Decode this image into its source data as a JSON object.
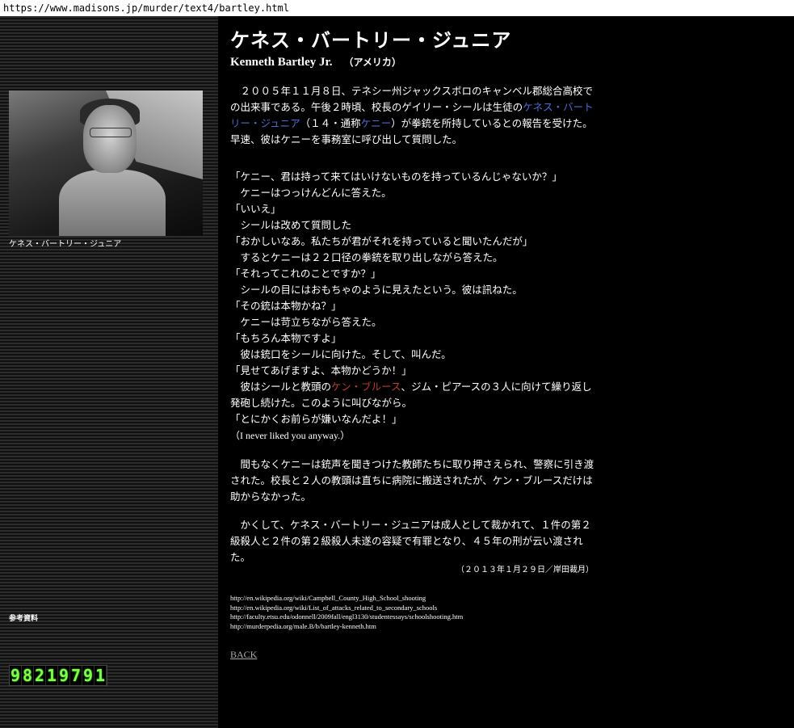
{
  "url": "https://www.madisons.jp/murder/text4/bartley.html",
  "sidebar": {
    "photo_caption": "ケネス・バートリー・ジュニア",
    "refs_label": "参考資料",
    "counter_digits": [
      "9",
      "8",
      "2",
      "1",
      "9",
      "7",
      "9",
      "1"
    ]
  },
  "header": {
    "title_ja": "ケネス・バートリー・ジュニア",
    "title_en": "Kenneth Bartley Jr.",
    "country": "（アメリカ）"
  },
  "p1": {
    "a": "　２００５年１１月８日、テネシー州ジャックスボロのキャンベル郡総合高校での出来事である。午後２時頃、校長のゲイリー・シールは生徒の",
    "link1": "ケネス・バートリー・ジュニア",
    "b": "（１４・通称",
    "link2": "ケニー",
    "c": "）が拳銃を所持しているとの報告を受けた。早速、彼はケニーを事務室に呼び出して質問した。"
  },
  "dialog": {
    "l1": "「ケニー、君は持って来てはいけないものを持っているんじゃないか？」",
    "l2": "　ケニーはつっけんどんに答えた。",
    "l3": "「いいえ」",
    "l4": "　シールは改めて質問した",
    "l5": "「おかしいなあ。私たちが君がそれを持っていると聞いたんだが」",
    "l6": "　するとケニーは２２口径の拳銃を取り出しながら答えた。",
    "l7": "「それってこれのことですか？」",
    "l8": "　シールの目にはおもちゃのように見えたという。彼は訊ねた。",
    "l9": "「その銃は本物かね？」",
    "l10": "　ケニーは苛立ちながら答えた。",
    "l11": "「もちろん本物ですよ」",
    "l12": "　彼は銃口をシールに向けた。そして、叫んだ。",
    "l13": "「見せてあげますよ、本物かどうか！」",
    "l14a": "　彼はシールと教頭の",
    "l14link": "ケン・ブルース",
    "l14b": "、ジム・ピアースの３人に向けて繰り返し発砲し続けた。このように叫びながら。",
    "l15": "「とにかくお前らが嫌いなんだよ！」",
    "l16": "（I never liked you anyway.）"
  },
  "p3": "　間もなくケニーは銃声を聞きつけた教師たちに取り押さえられ、警察に引き渡された。校長と２人の教頭は直ちに病院に搬送されたが、ケン・ブルースだけは助からなかった。",
  "p4": "　かくして、ケネス・バートリー・ジュニアは成人として裁かれて、１件の第２級殺人と２件の第２級殺人未遂の容疑で有罪となり、４５年の刑が云い渡された。",
  "date": "（２０１３年１月２９日／岸田裁月）",
  "references": [
    "http://en.wikipedia.org/wiki/Campbell_County_High_School_shooting",
    "http://en.wikipedia.org/wiki/List_of_attacks_related_to_secondary_schools",
    "http://faculty.etsu.edu/odonnell/2009fall/engl3130/studentessays/schoolshooting.htm",
    "http://murderpedia.org/male.B/b/bartley-kenneth.htm"
  ],
  "back_label": "BACK"
}
